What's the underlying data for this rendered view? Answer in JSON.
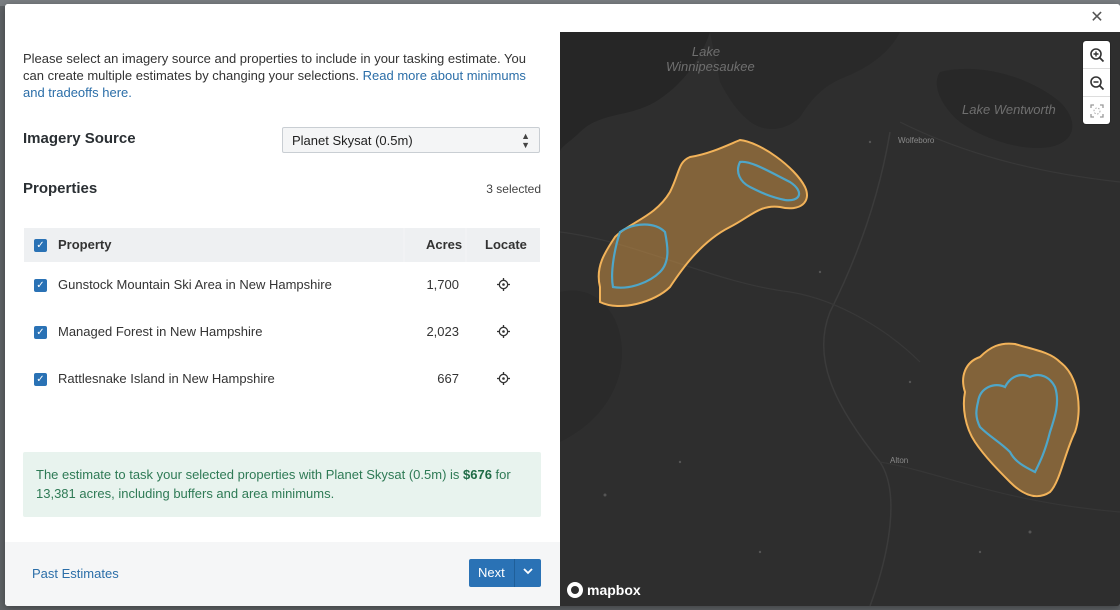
{
  "modal": {
    "close_icon": "close-icon",
    "intro_text": "Please select an imagery source and properties to include in your tasking estimate. You can create multiple estimates by changing your selections. ",
    "intro_link": "Read more about minimums and tradeoffs here.",
    "imagery_label": "Imagery Source",
    "imagery_selected": "Planet Skysat (0.5m)",
    "properties_label": "Properties",
    "selected_count": "3 selected",
    "table": {
      "headers": {
        "property": "Property",
        "acres": "Acres",
        "locate": "Locate"
      },
      "rows": [
        {
          "name": "Gunstock Mountain Ski Area in New Hampshire",
          "acres": "1,700",
          "checked": true
        },
        {
          "name": "Managed Forest in New Hampshire",
          "acres": "2,023",
          "checked": true
        },
        {
          "name": "Rattlesnake Island in New Hampshire",
          "acres": "667",
          "checked": true
        }
      ]
    },
    "estimate": {
      "prefix": "The estimate to task your selected properties with Planet Skysat (0.5m) is ",
      "price": "$676",
      "suffix": " for 13,381 acres, including buffers and area minimums."
    },
    "footer": {
      "past_estimates": "Past Estimates",
      "next": "Next"
    }
  },
  "map": {
    "labels": {
      "lake_winnipesaukee": "Lake Winnipesaukee",
      "lake_wentworth": "Lake Wentworth",
      "wolfeboro": "Wolfeboro",
      "alton": "Alton"
    },
    "attribution": "mapbox",
    "controls": [
      "zoom-in-icon",
      "zoom-out-icon",
      "fit-bounds-icon"
    ],
    "colors": {
      "background": "#2e2e2e",
      "buffer": "#f2b35a",
      "parcel": "#4fa6c8"
    }
  },
  "colors": {
    "primary": "#2a72b5",
    "link": "#2b6ea8",
    "estimate_bg": "#e8f3ee",
    "estimate_text": "#2e7a55"
  }
}
